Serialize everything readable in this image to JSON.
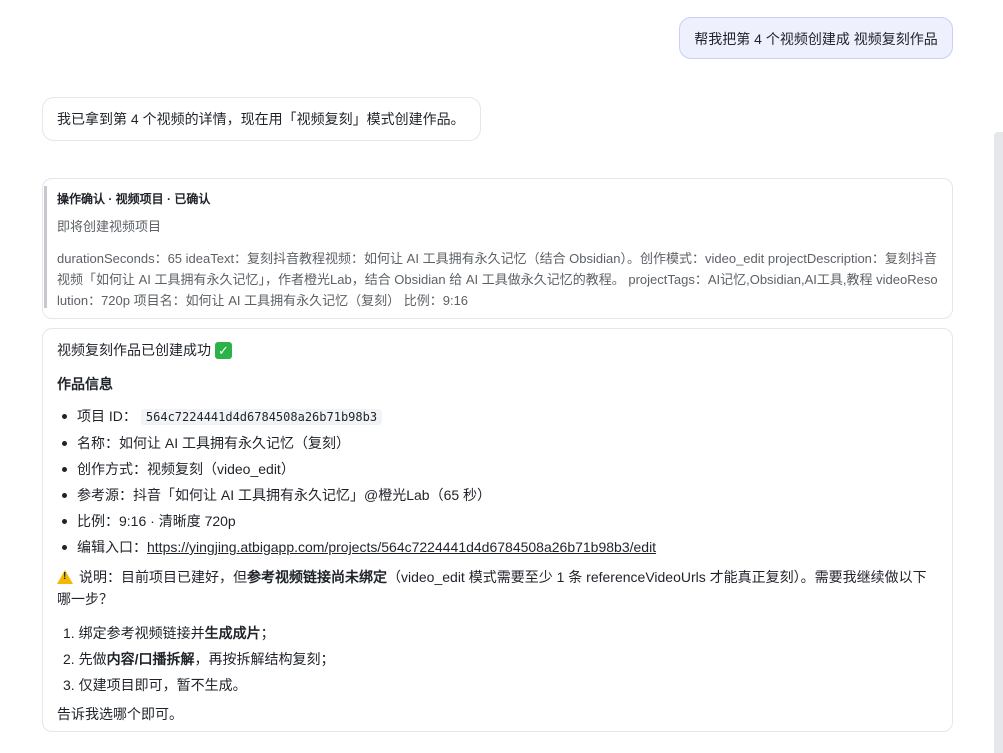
{
  "user_message": "帮我把第 4 个视频创建成 视频复刻作品",
  "assistant_message": "我已拿到第 4 个视频的详情，现在用「视频复刻」模式创建作品。",
  "confirm_card": {
    "title": "操作确认 · 视频项目 · 已确认",
    "subtitle": "即将创建视频项目",
    "description": "durationSeconds：65 ideaText：复刻抖音教程视频：如何让 AI 工具拥有永久记忆（结合 Obsidian）。创作模式：video_edit projectDescription：复刻抖音视频「如何让 AI 工具拥有永久记忆」，作者橙光Lab，结合 Obsidian 给 AI 工具做永久记忆的教程。 projectTags：AI记忆,Obsidian,AI工具,教程 videoResolution：720p 项目名：如何让 AI 工具拥有永久记忆（复刻） 比例：9:16"
  },
  "result": {
    "title": "视频复刻作品已创建成功",
    "section_title": "作品信息",
    "items": {
      "project_id_label": "项目 ID：",
      "project_id": "564c7224441d4d6784508a26b71b98b3",
      "name": "名称：如何让 AI 工具拥有永久记忆（复刻）",
      "mode": "创作方式：视频复刻（video_edit）",
      "source": "参考源：抖音「如何让 AI 工具拥有永久记忆」@橙光Lab（65 秒）",
      "ratio": "比例：9:16 · 清晰度 720p",
      "edit_label": "编辑入口：",
      "edit_url": "https://yingjing.atbigapp.com/projects/564c7224441d4d6784508a26b71b98b3/edit"
    },
    "note": {
      "prefix": "说明：目前项目已建好，但",
      "bold": "参考视频链接尚未绑定",
      "suffix": "（video_edit 模式需要至少 1 条 referenceVideoUrls 才能真正复刻）。需要我继续做以下哪一步？"
    },
    "steps": [
      {
        "num": "1.",
        "pre": "绑定参考视频链接并",
        "bold": "生成成片",
        "post": "；"
      },
      {
        "num": "2.",
        "pre": "先做",
        "bold": "内容/口播拆解",
        "post": "，再按拆解结构复刻；"
      },
      {
        "num": "3.",
        "pre": "仅建项目即可，暂不生成。",
        "bold": "",
        "post": ""
      }
    ],
    "footer": "告诉我选哪个即可。"
  },
  "colors": {
    "user_bubble_bg": "#eef0fd",
    "user_bubble_border": "#c9cff5",
    "success_check": "#2bb34a",
    "warning": "#f5b800"
  },
  "icons": [
    "check-mark-icon",
    "warning-icon"
  ]
}
